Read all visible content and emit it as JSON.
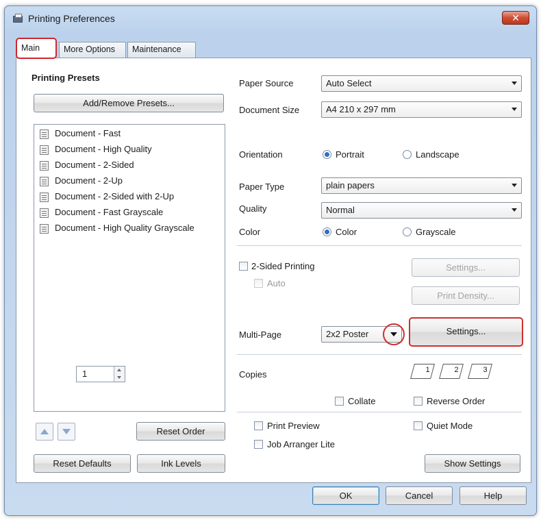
{
  "window": {
    "title": "Printing Preferences",
    "close_label": "✕"
  },
  "tabs": [
    {
      "label": "Main"
    },
    {
      "label": "More Options"
    },
    {
      "label": "Maintenance"
    }
  ],
  "presets": {
    "heading": "Printing Presets",
    "add_remove_label": "Add/Remove Presets...",
    "items": [
      "Document - Fast",
      "Document - High Quality",
      "Document - 2-Sided",
      "Document - 2-Up",
      "Document - 2-Sided with 2-Up",
      "Document - Fast Grayscale",
      "Document - High Quality Grayscale"
    ],
    "reset_order_label": "Reset Order"
  },
  "left_buttons": {
    "reset_defaults": "Reset Defaults",
    "ink_levels": "Ink Levels"
  },
  "paper": {
    "source_label": "Paper Source",
    "source_value": "Auto Select",
    "size_label": "Document Size",
    "size_value": "A4 210 x 297 mm",
    "orientation_label": "Orientation",
    "portrait": "Portrait",
    "landscape": "Landscape",
    "type_label": "Paper Type",
    "type_value": "plain papers",
    "quality_label": "Quality",
    "quality_value": "Normal",
    "color_label": "Color",
    "color_option": "Color",
    "grayscale_option": "Grayscale"
  },
  "two_sided": {
    "label": "2-Sided Printing",
    "auto_label": "Auto",
    "settings_label": "Settings...",
    "print_density_label": "Print Density..."
  },
  "multipage": {
    "label": "Multi-Page",
    "value": "2x2 Poster",
    "settings_label": "Settings..."
  },
  "copies": {
    "label": "Copies",
    "value": "1",
    "page_icons": [
      "1",
      "2",
      "3"
    ],
    "collate_label": "Collate",
    "reverse_order_label": "Reverse Order"
  },
  "options": {
    "print_preview": "Print Preview",
    "job_arranger": "Job Arranger Lite",
    "quiet_mode": "Quiet Mode",
    "show_settings": "Show Settings"
  },
  "footer": {
    "ok": "OK",
    "cancel": "Cancel",
    "help": "Help"
  }
}
